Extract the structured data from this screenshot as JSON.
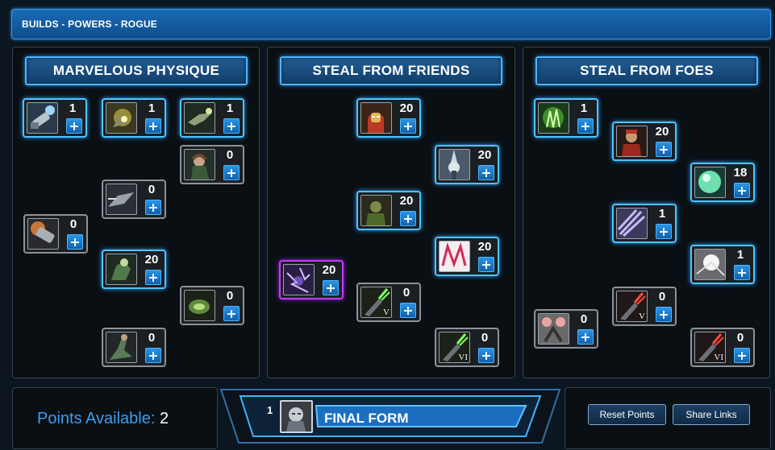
{
  "header": {
    "breadcrumb": "BUILDS - POWERS - ROGUE"
  },
  "columns": [
    {
      "title": "MARVELOUS PHYSIQUE",
      "nodes": [
        {
          "rank": "1",
          "icon": "armored-fist-icon"
        },
        {
          "rank": "1",
          "icon": "energy-shield-icon"
        },
        {
          "rank": "1",
          "icon": "flying-figure-icon"
        },
        {
          "rank": "0",
          "icon": "rogue-portrait-icon"
        },
        {
          "rank": "0",
          "icon": "dash-icon"
        },
        {
          "rank": "0",
          "icon": "fiery-punch-icon"
        },
        {
          "rank": "20",
          "icon": "crouching-figure-icon"
        },
        {
          "rank": "0",
          "icon": "green-burst-icon"
        },
        {
          "rank": "0",
          "icon": "kick-icon"
        }
      ]
    },
    {
      "title": "STEAL FROM FRIENDS",
      "nodes": [
        {
          "rank": "20",
          "icon": "iron-man-icon"
        },
        {
          "rank": "20",
          "icon": "raised-fist-icon"
        },
        {
          "rank": "20",
          "icon": "green-hero-icon"
        },
        {
          "rank": "20",
          "icon": "red-lightning-icon"
        },
        {
          "rank": "20",
          "icon": "purple-storm-icon"
        },
        {
          "rank": "0",
          "icon": "glove-v-icon",
          "numeral": "V"
        },
        {
          "rank": "0",
          "icon": "glove-vi-icon",
          "numeral": "VI"
        }
      ]
    },
    {
      "title": "STEAL FROM FOES",
      "nodes": [
        {
          "rank": "1",
          "icon": "green-hand-icon"
        },
        {
          "rank": "20",
          "icon": "red-villain-icon"
        },
        {
          "rank": "18",
          "icon": "green-orb-icon"
        },
        {
          "rank": "1",
          "icon": "purple-claws-icon"
        },
        {
          "rank": "1",
          "icon": "white-flash-icon"
        },
        {
          "rank": "0",
          "icon": "grabbing-hands-icon"
        },
        {
          "rank": "0",
          "icon": "red-glove-v-icon",
          "numeral": "V"
        },
        {
          "rank": "0",
          "icon": "red-glove-vi-icon",
          "numeral": "VI"
        }
      ]
    }
  ],
  "footer": {
    "points_label": "Points Available:",
    "points_value": "2",
    "final_form_count": "1",
    "final_form_label": "FINAL FORM",
    "reset_label": "Reset Points",
    "share_label": "Share Links"
  }
}
